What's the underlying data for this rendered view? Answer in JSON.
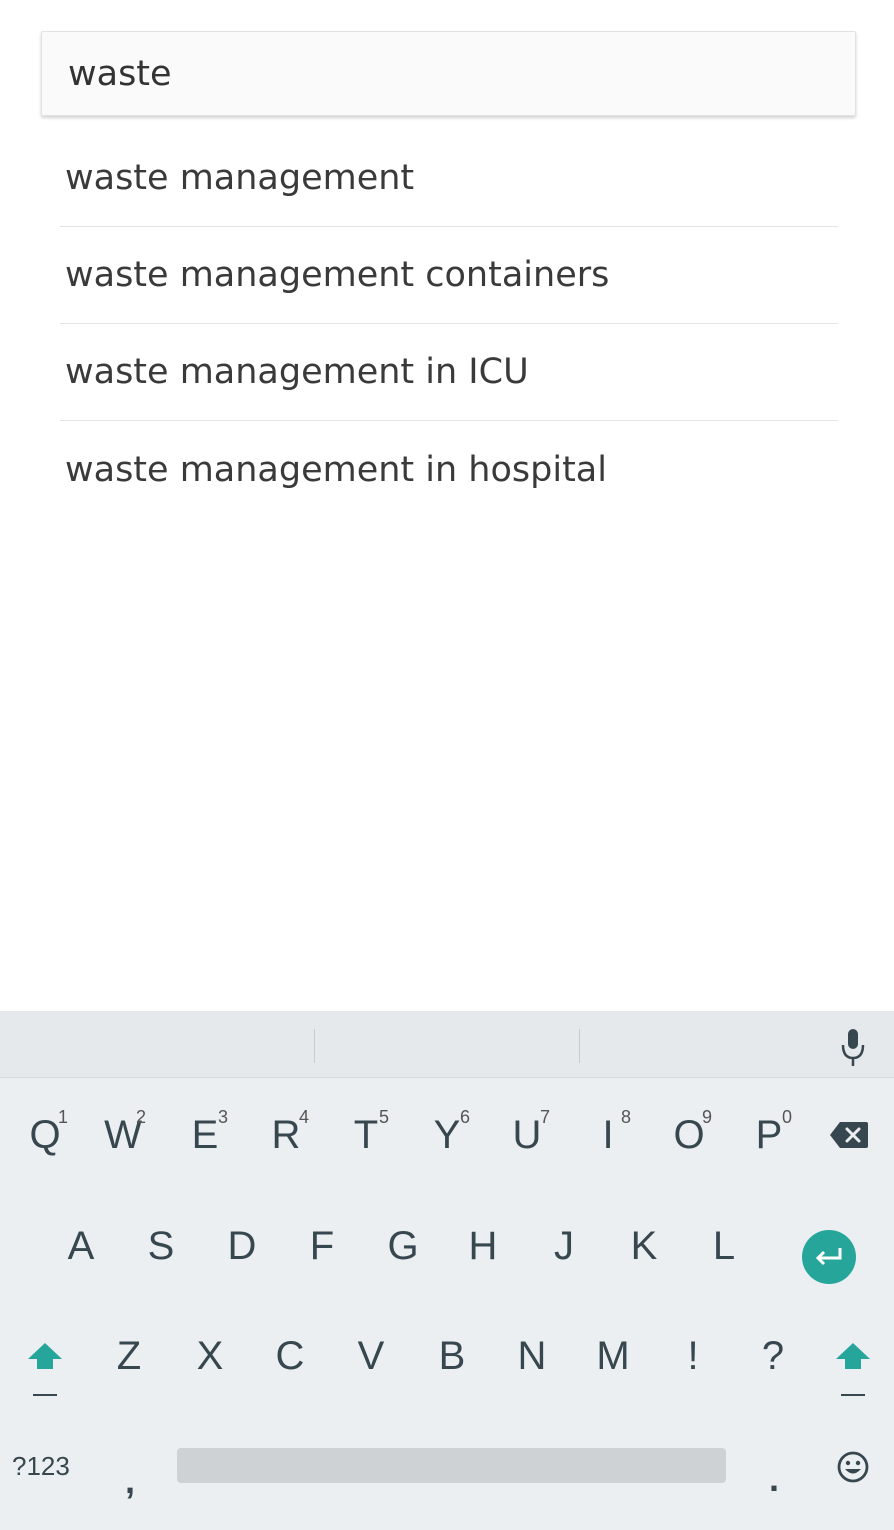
{
  "search": {
    "value": "waste"
  },
  "suggestions": [
    "waste management",
    "waste management containers",
    "waste management in ICU",
    "waste management in hospital"
  ],
  "keyboard": {
    "row1": [
      {
        "label": "Q",
        "hint": "1"
      },
      {
        "label": "W",
        "hint": "2"
      },
      {
        "label": "E",
        "hint": "3"
      },
      {
        "label": "R",
        "hint": "4"
      },
      {
        "label": "T",
        "hint": "5"
      },
      {
        "label": "Y",
        "hint": "6"
      },
      {
        "label": "U",
        "hint": "7"
      },
      {
        "label": "I",
        "hint": "8"
      },
      {
        "label": "O",
        "hint": "9"
      },
      {
        "label": "P",
        "hint": "0"
      }
    ],
    "row2": [
      "A",
      "S",
      "D",
      "F",
      "G",
      "H",
      "J",
      "K",
      "L"
    ],
    "row3": [
      "Z",
      "X",
      "C",
      "V",
      "B",
      "N",
      "M",
      "!",
      "?"
    ],
    "symbols_label": "?123",
    "comma_label": ",",
    "period_label": ".",
    "icons": [
      "mic-icon",
      "backspace-icon",
      "enter-icon",
      "shift-icon",
      "emoji-icon"
    ],
    "accent_color": "#26a69a"
  }
}
